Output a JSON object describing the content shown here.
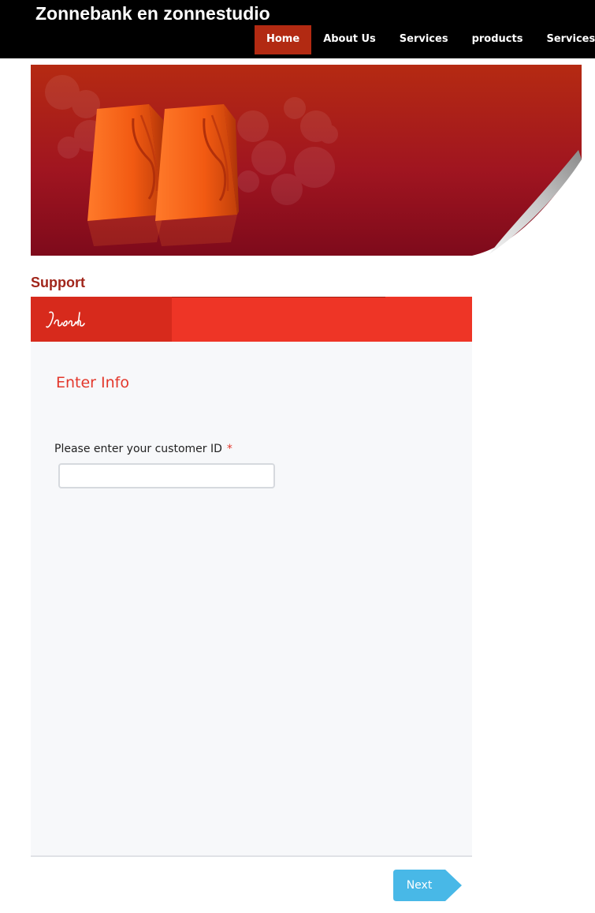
{
  "header": {
    "site_title": "Zonnebank en zonnestudio",
    "nav": [
      {
        "label": "Home",
        "active": true
      },
      {
        "label": "About Us",
        "active": false
      },
      {
        "label": "Services",
        "active": false
      },
      {
        "label": "products",
        "active": false
      },
      {
        "label": "Services",
        "active": false
      }
    ]
  },
  "banner": {
    "image": "orange-shopping-bags-banner"
  },
  "page": {
    "section_title": "Support"
  },
  "form": {
    "logo_text": "Jasada",
    "heading": "Enter Info",
    "fields": [
      {
        "label": "Please enter your customer ID",
        "required_mark": "*",
        "value": "",
        "placeholder": ""
      }
    ],
    "next_label": "Next"
  },
  "colors": {
    "nav_active": "#b22a12",
    "section_title": "#a1261b",
    "form_header": "#ee3526",
    "accent": "#e3372b",
    "next_button": "#48b8e7"
  }
}
